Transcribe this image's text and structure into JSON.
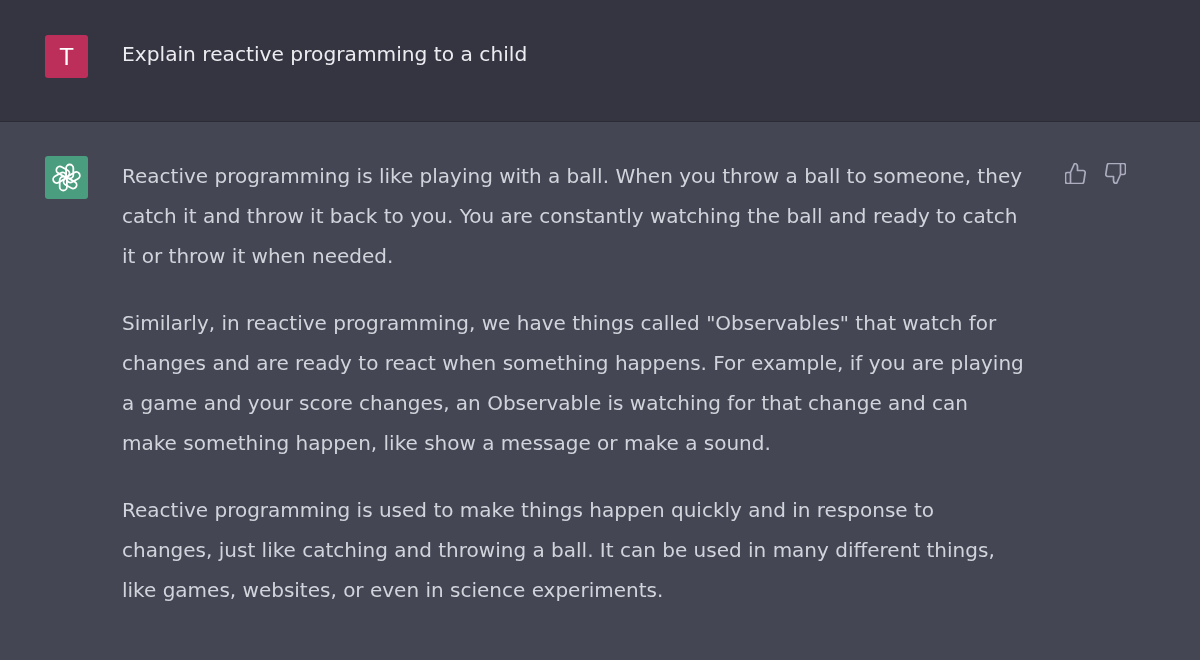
{
  "messages": [
    {
      "kind": "user",
      "avatar": "T",
      "text": "Explain reactive programming to a child"
    },
    {
      "kind": "assistant",
      "paragraphs": [
        "Reactive programming is like playing with a ball. When you throw a ball to someone, they catch it and throw it back to you. You are constantly watching the ball and ready to catch it or throw it when needed.",
        "Similarly, in reactive programming, we have things called \"Observables\" that watch for changes and are ready to react when something happens. For example, if you are playing a game and your score changes, an Observable is watching for that change and can make something happen, like show a message or make a sound.",
        "Reactive programming is used to make things happen quickly and in response to changes, just like catching and throwing a ball. It can be used in many different things, like games, websites, or even in science experiments."
      ]
    }
  ]
}
